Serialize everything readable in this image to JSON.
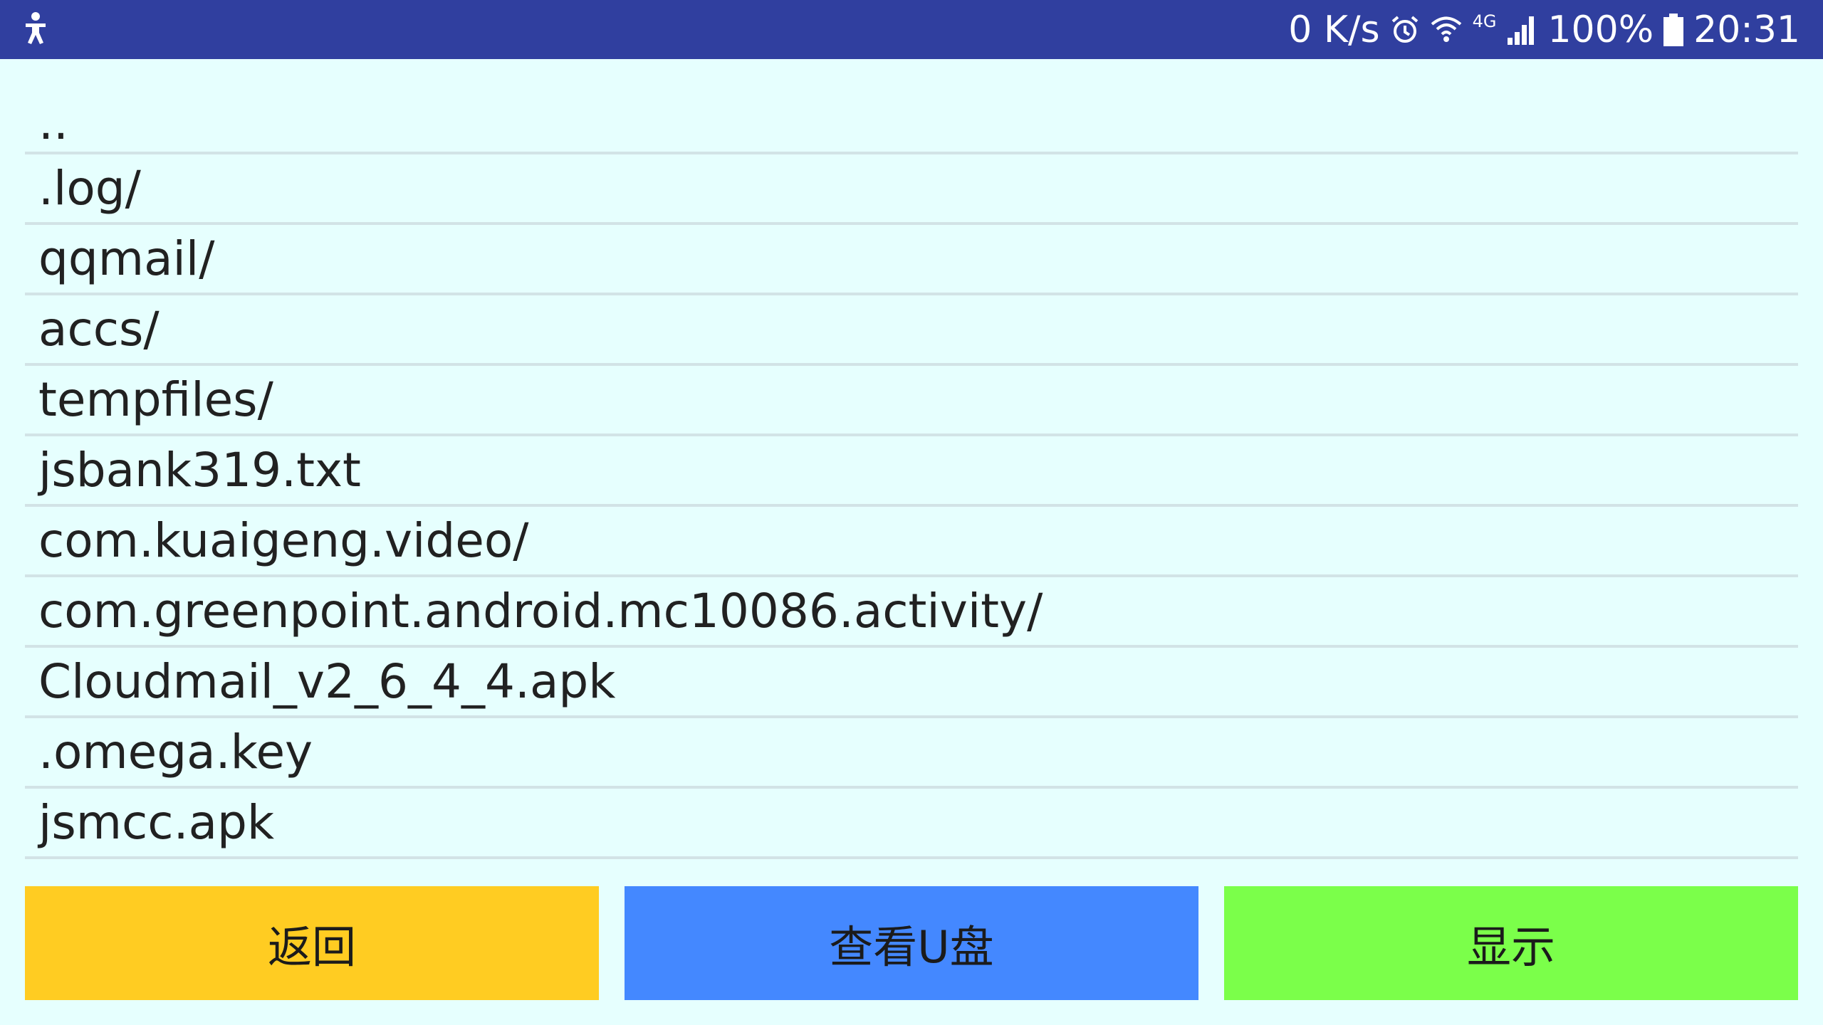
{
  "status_bar": {
    "network_speed": "0 K/s",
    "network_type": "4G",
    "battery_percent": "100%",
    "time": "20:31",
    "icons": [
      "accessibility-icon",
      "alarm-icon",
      "wifi-icon",
      "signal-icon",
      "battery-icon"
    ]
  },
  "file_list": {
    "items": [
      "..",
      ".log/",
      "qqmail/",
      "accs/",
      "tempfiles/",
      "jsbank319.txt",
      "com.kuaigeng.video/",
      "com.greenpoint.android.mc10086.activity/",
      "Cloudmail_v2_6_4_4.apk",
      ".omega.key",
      "jsmcc.apk"
    ]
  },
  "buttons": {
    "back": "返回",
    "view_usb": "查看U盘",
    "show": "显示"
  },
  "colors": {
    "status_bar": "#303f9f",
    "background": "#e6fffe",
    "back_button": "#ffcc22",
    "usb_button": "#4488ff",
    "show_button": "#7bff4a"
  }
}
